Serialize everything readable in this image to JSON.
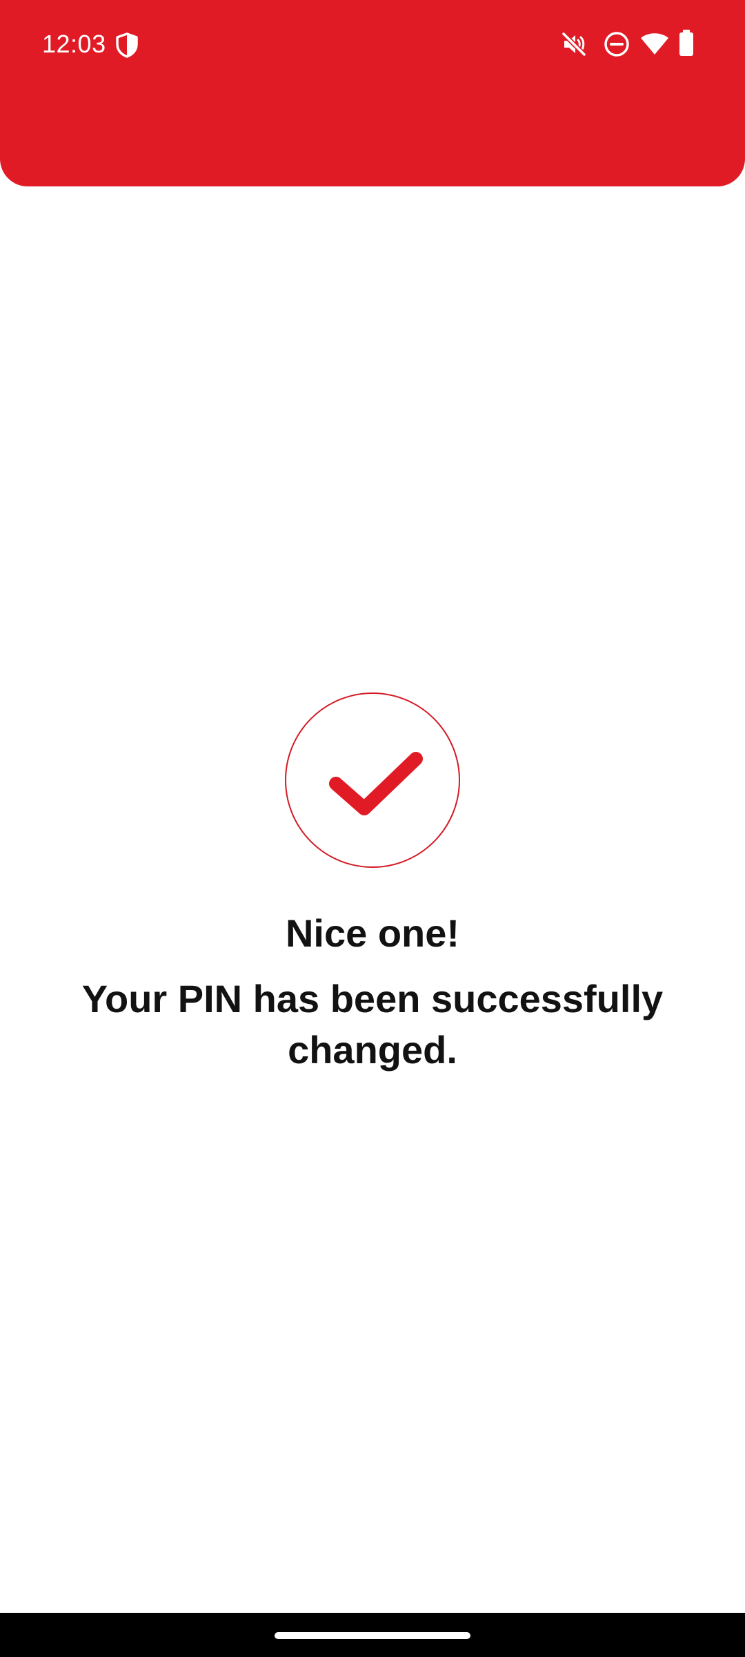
{
  "status_bar": {
    "time": "12:03",
    "icons": [
      "shield-icon",
      "mute-icon",
      "do-not-disturb-icon",
      "wifi-icon",
      "battery-icon"
    ]
  },
  "colors": {
    "brand_red": "#e11b25",
    "text": "#121212",
    "background": "#ffffff"
  },
  "success": {
    "icon": "checkmark-icon",
    "title": "Nice one!",
    "message": "Your PIN has been successfully changed."
  }
}
